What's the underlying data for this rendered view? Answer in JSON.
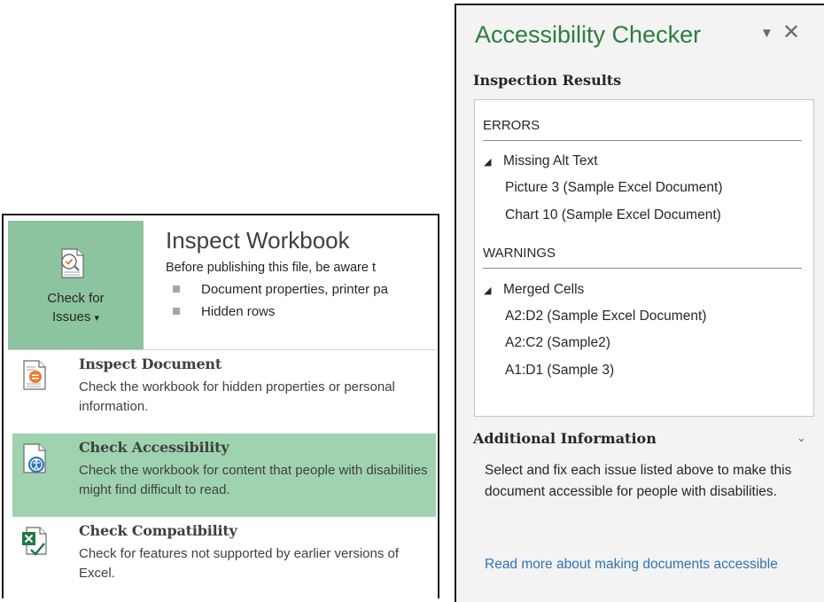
{
  "check_for_issues": {
    "line1": "Check for",
    "line2": "Issues",
    "caret": "▾"
  },
  "inspect": {
    "title": "Inspect Workbook",
    "description": "Before publishing this file, be aware t",
    "bullets": [
      "Document properties, printer pa",
      "Hidden rows"
    ]
  },
  "menu": [
    {
      "title": "Inspect Document",
      "desc": "Check the workbook for hidden properties or personal information.",
      "icon": "inspect-document-icon"
    },
    {
      "title": "Check Accessibility",
      "desc": "Check the workbook for content that people with disabilities might find difficult to read.",
      "icon": "accessibility-icon"
    },
    {
      "title": "Check Compatibility",
      "desc": "Check for features not supported by earlier versions of Excel.",
      "icon": "excel-compatibility-icon"
    }
  ],
  "pane": {
    "title": "Accessibility Checker",
    "menu_glyph": "▼",
    "close_glyph": "✕",
    "inspection_results": "Inspection Results",
    "errors": {
      "heading": "ERRORS",
      "category": "Missing Alt Text",
      "items": [
        "Picture 3 (Sample Excel Document)",
        "Chart 10 (Sample Excel Document)"
      ]
    },
    "warnings": {
      "heading": "WARNINGS",
      "category": "Merged Cells",
      "items": [
        "A2:D2 (Sample Excel Document)",
        "A2:C2 (Sample2)",
        "A1:D1 (Sample 3)"
      ]
    },
    "additional_info": "Additional Information",
    "additional_text": "Select and fix each issue listed above to make this document accessible for people with disabilities.",
    "read_more": "Read more about making documents accessible",
    "collapse_glyph": "⌄",
    "expand_glyph": "◢"
  }
}
